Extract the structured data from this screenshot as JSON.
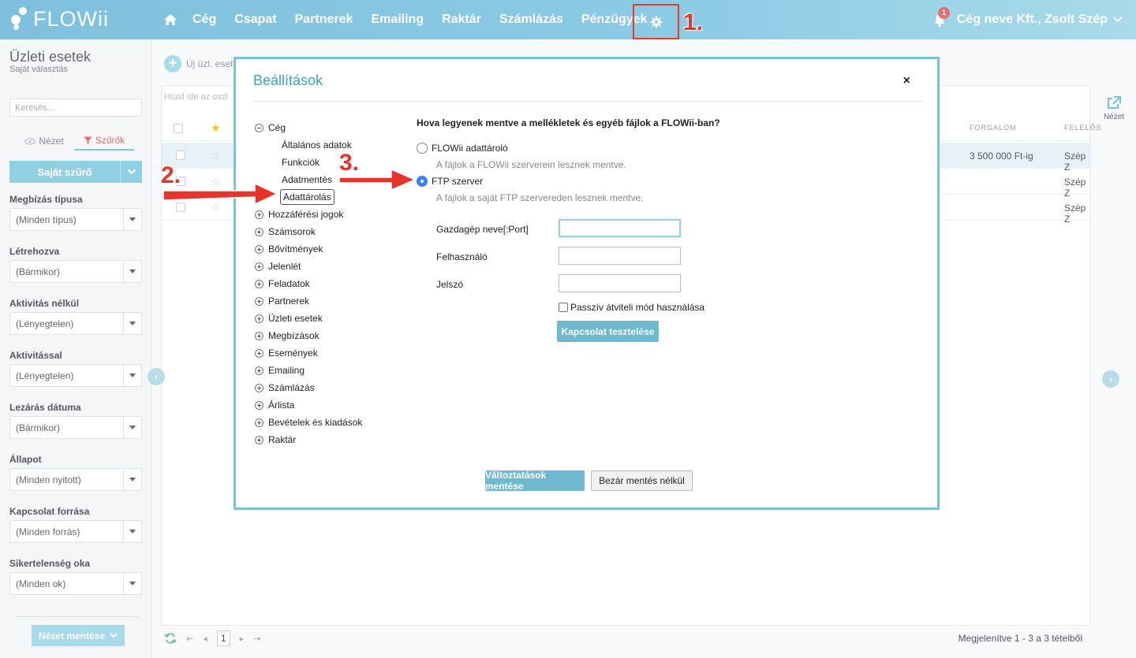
{
  "app": {
    "logo_text": "FLOWii",
    "nav": [
      "Cég",
      "Csapat",
      "Partnerek",
      "Emailing",
      "Raktár",
      "Számlázás",
      "Pénzügyek"
    ],
    "notification_count": "1",
    "user_label": "Cég neve Kft., Zsolt Szép"
  },
  "annotations": {
    "step1": "1.",
    "step2": "2.",
    "step3": "3."
  },
  "sidebar": {
    "title": "Üzleti esetek",
    "subtitle": "Saját választás",
    "search_placeholder": "Keresés...",
    "tab_view": "Nézet",
    "tab_filters": "Szűrők",
    "own_filter_button": "Saját szűrő",
    "filters": [
      {
        "label": "Megbízás típusa",
        "value": "(Minden típus)"
      },
      {
        "label": "Létrehozva",
        "value": "(Bármikor)"
      },
      {
        "label": "Aktivitás nélkül",
        "value": "(Lényegtelen)"
      },
      {
        "label": "Aktivitással",
        "value": "(Lényegtelen)"
      },
      {
        "label": "Lezárás dátuma",
        "value": "(Bármikor)"
      },
      {
        "label": "Állapot",
        "value": "(Minden nyitott)"
      },
      {
        "label": "Kapcsolat forrása",
        "value": "(Minden forrás)"
      },
      {
        "label": "Sikertelenség oka",
        "value": "(Minden ok)"
      }
    ],
    "save_view_button": "Nézet mentése"
  },
  "main": {
    "add_button": "Új üzl. eset",
    "group_hint": "Húzd ide az oszl",
    "col_turnover": "FORGALOM",
    "col_owner": "FELELŐS",
    "rows": [
      {
        "turnover": "3 500 000 Ft-ig",
        "owner": "Szép Z"
      },
      {
        "turnover": "",
        "owner": "Szép Z"
      },
      {
        "turnover": "",
        "owner": "Szép Z"
      }
    ],
    "right_view_label": "Nézet",
    "page_number": "1",
    "footer_info": "Megjelenítve 1 - 3 a 3 tételből"
  },
  "modal": {
    "title": "Beállítások",
    "close": "×",
    "tree": {
      "root": "Cég",
      "children": [
        "Általános adatok",
        "Funkciók",
        "Adatmentés",
        "Adattárolás"
      ],
      "active_child": "Adattárolás",
      "others": [
        "Hozzáférési jogok",
        "Számsorok",
        "Bővítmények",
        "Jelenlét",
        "Feladatok",
        "Partnerek",
        "Üzleti esetek",
        "Megbízások",
        "Események",
        "Emailing",
        "Számlázás",
        "Árlista",
        "Bevételek és kiadások",
        "Raktár"
      ]
    },
    "question": "Hova legyenek mentve a mellékletek és egyéb fájlok a FLOWii-ban?",
    "option1_label": "FLOWii adattároló",
    "option1_desc": "A fájlok a FLOWii szerverein lesznek mentve.",
    "option2_label": "FTP szerver",
    "option2_desc": "A fájlok a saját FTP szervereden lesznek mentve.",
    "host_label": "Gazdagép neve[:Port]",
    "user_label": "Felhasználó",
    "password_label": "Jelszó",
    "passive_label": "Passzív átviteli mód használása",
    "test_button": "Kapcsolat tesztelése",
    "save_button": "Változtatások mentése",
    "close_button": "Bezár mentés nélkül"
  },
  "colors": {
    "accent": "#6fb9cf",
    "annotation": "#e8322a",
    "title": "#3fa0c6"
  }
}
